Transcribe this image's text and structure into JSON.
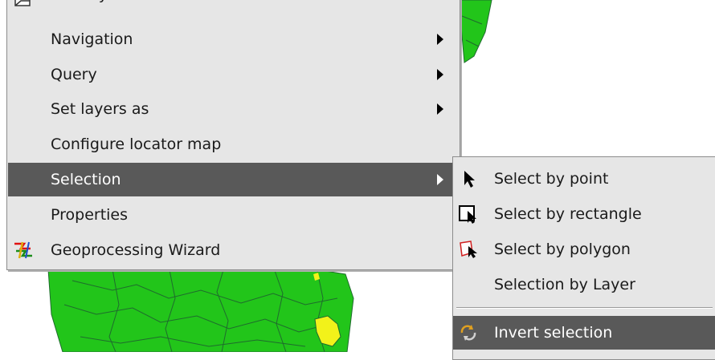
{
  "main_menu": {
    "items": [
      {
        "label": "Add layer"
      },
      {
        "label": "Navigation"
      },
      {
        "label": "Query"
      },
      {
        "label": "Set layers as"
      },
      {
        "label": "Configure locator map"
      },
      {
        "label": "Selection"
      },
      {
        "label": "Properties"
      },
      {
        "label": "Geoprocessing Wizard"
      }
    ]
  },
  "selection_submenu": {
    "items": [
      {
        "label": "Select by point"
      },
      {
        "label": "Select by rectangle"
      },
      {
        "label": "Select by polygon"
      },
      {
        "label": "Selection by Layer"
      },
      {
        "label": "Invert selection"
      }
    ]
  },
  "colors": {
    "menu_background": "#e6e6e6",
    "highlight": "#595959",
    "map_green": "#22c51a",
    "map_boundary": "#1f6b2e",
    "map_yellow": "#f2f21a"
  },
  "icons": [
    "add-layer-icon",
    "geoprocessing-icon",
    "arrow-pointer-icon",
    "select-rectangle-icon",
    "select-polygon-icon",
    "invert-selection-icon"
  ]
}
